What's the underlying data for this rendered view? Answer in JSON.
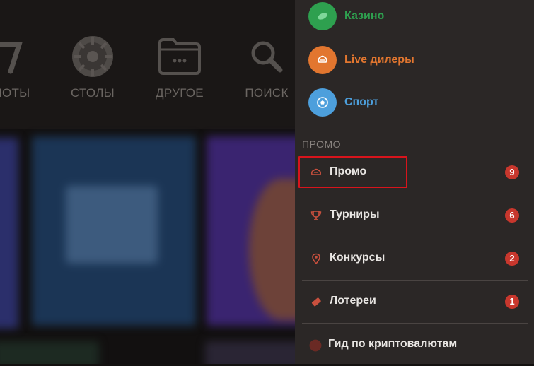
{
  "top_nav": {
    "items": [
      {
        "label": "ЛОТЫ",
        "icon": "slot-machine-icon"
      },
      {
        "label": "СТОЛЫ",
        "icon": "roulette-icon"
      },
      {
        "label": "ДРУГОЕ",
        "icon": "folder-icon"
      },
      {
        "label": "ПОИСК",
        "icon": "search-icon"
      }
    ]
  },
  "menu": {
    "categories": [
      {
        "label": "Казино",
        "color": "#2ea04f",
        "icon": "casino-icon"
      },
      {
        "label": "Live дилеры",
        "color": "#e2762f",
        "icon": "live-dealer-icon"
      },
      {
        "label": "Спорт",
        "color": "#4d9fdc",
        "icon": "soccer-ball-icon"
      }
    ],
    "section_title": "ПРОМО",
    "items": [
      {
        "label": "Промо",
        "badge": "9",
        "icon": "promo-icon"
      },
      {
        "label": "Турниры",
        "badge": "6",
        "icon": "trophy-icon"
      },
      {
        "label": "Конкурсы",
        "badge": "2",
        "icon": "location-pin-icon"
      },
      {
        "label": "Лотереи",
        "badge": "1",
        "icon": "ticket-icon"
      },
      {
        "label": "Гид по криптовалютам",
        "icon": "crypto-icon"
      }
    ]
  },
  "colors": {
    "menu_bg": "#2b2726",
    "badge": "#c8372d",
    "accent_icon": "#c9503e",
    "highlight": "#d8141c"
  }
}
